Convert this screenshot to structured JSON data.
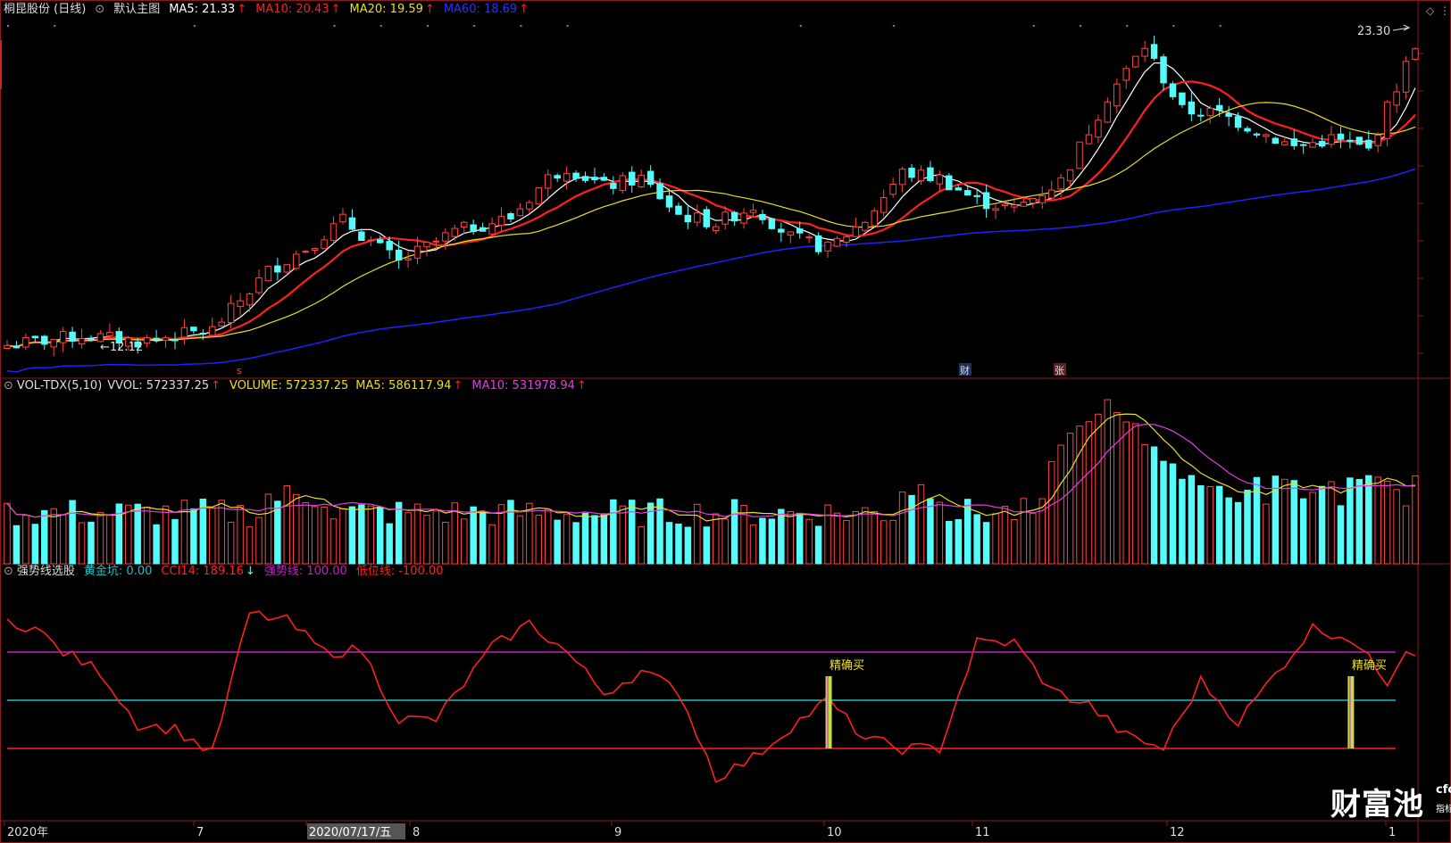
{
  "header": {
    "stock": "桐昆股份 (日线)",
    "template": "默认主图",
    "ma5": "MA5: 21.33",
    "ma10": "MA10: 20.43",
    "ma20": "MA20: 19.59",
    "ma60": "MA60: 18.69",
    "arrow": "↑"
  },
  "volume_header": {
    "name": "VOL-TDX(5,10)",
    "vvol": "VVOL: 572337.25",
    "volume": "VOLUME: 572337.25",
    "ma5": "MA5: 586117.94",
    "ma10": "MA10: 531978.94",
    "arrow": "↑"
  },
  "indicator_header": {
    "name": "强势线选股",
    "gold": "黄金坑: 0.00",
    "cci": "CCI14: 189.16",
    "cci_arrow": "↓",
    "strong": "强势线: 100.00",
    "low": "低位线: -100.00"
  },
  "price_labels": {
    "high": "23.30",
    "low": "12.12"
  },
  "markers": {
    "s": "s",
    "cai": "财",
    "zhang": "张"
  },
  "signal_label": "精确买",
  "x_axis": {
    "labels": [
      "2020年",
      "7",
      "2020/07/17/五",
      "8",
      "9",
      "10",
      "11",
      "12",
      "1"
    ]
  },
  "logo": {
    "main": "财富池",
    "site": "cfchi.com",
    "tagline": "指标交易平台"
  },
  "colors": {
    "background": "#000000",
    "up": "#ff4444",
    "down": "#54fcfc",
    "ma5": "#ffffff",
    "ma10": "#ff2020",
    "ma20": "#e8e020",
    "ma60": "#2020ff",
    "vol_ma10": "#e040e0",
    "strong_line": "#c020c0",
    "gold_line": "#20c0c0",
    "low_line": "#ff2020",
    "cci": "#ff2020"
  },
  "chart_data": [
    {
      "type": "candlestick",
      "title": "桐昆股份 (日线)",
      "ylim": [
        11.5,
        24.0
      ],
      "close_start": 12.4,
      "close_end": 23.3,
      "observed_high": 23.3,
      "observed_low": 12.12,
      "key_points_approx": [
        {
          "label": "2020年",
          "close": 12.4
        },
        {
          "label": "7",
          "close": 13.0
        },
        {
          "label": "8",
          "close": 16.6
        },
        {
          "label": "9",
          "close": 18.6
        },
        {
          "label": "10",
          "close": 15.5
        },
        {
          "label": "11",
          "close": 17.0
        },
        {
          "label": "12",
          "close": 20.0
        },
        {
          "label": "1",
          "close": 22.8
        }
      ]
    },
    {
      "type": "bar",
      "title": "VOL-TDX(5,10)",
      "last_volume": 572337.25,
      "ma5": 586117.94,
      "ma10": 531978.94
    },
    {
      "type": "line",
      "title": "强势线选股",
      "series": [
        {
          "name": "CCI14",
          "last": 189.16
        },
        {
          "name": "强势线",
          "value": 100.0
        },
        {
          "name": "低位线",
          "value": -100.0
        },
        {
          "name": "黄金坑",
          "value": 0.0
        }
      ],
      "ylim": [
        -250,
        250
      ]
    }
  ]
}
